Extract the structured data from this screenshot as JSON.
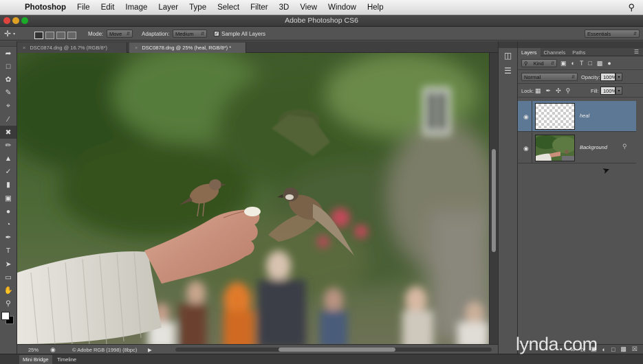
{
  "menubar": {
    "apple_icon": "apple-icon",
    "items": [
      "Photoshop",
      "File",
      "Edit",
      "Image",
      "Layer",
      "Type",
      "Select",
      "Filter",
      "3D",
      "View",
      "Window",
      "Help"
    ],
    "search_icon": "search-icon"
  },
  "window": {
    "title": "Adobe Photoshop CS6"
  },
  "options": {
    "mode_label": "Mode:",
    "mode_value": "Move",
    "adaptation_label": "Adaptation:",
    "adaptation_value": "Medium",
    "sample_all_layers": "Sample All Layers",
    "sample_checked": true,
    "workspace": "Essentials"
  },
  "tabs": [
    {
      "label": "DSC0874.dng @ 16.7% (RGB/8*)",
      "close": "×",
      "active": false
    },
    {
      "label": "DSC0878.dng @ 25% (heal, RGB/8*) *",
      "close": "×",
      "active": true
    }
  ],
  "tools": [
    "move",
    "marquee",
    "lasso",
    "quick-select",
    "crop",
    "eyedropper",
    "content-aware-move",
    "brush",
    "clone-stamp",
    "history-brush",
    "eraser",
    "gradient",
    "blur",
    "dodge",
    "pen",
    "type",
    "path-select",
    "shape",
    "hand",
    "zoom"
  ],
  "status": {
    "zoom": "25%",
    "profile": "© Adobe RGB (1998) (8bpc)",
    "arrow": "▶"
  },
  "bottom_tabs": [
    "Mini Bridge",
    "Timeline"
  ],
  "layers_panel": {
    "tabs": [
      "Layers",
      "Channels",
      "Paths"
    ],
    "menu_icon": "panel-menu-icon",
    "filter_kind": "Kind",
    "blend_mode": "Normal",
    "opacity_label": "Opacity:",
    "opacity_value": "100%",
    "lock_label": "Lock:",
    "fill_label": "Fill:",
    "fill_value": "100%",
    "layers": [
      {
        "name": "heal",
        "selected": true,
        "visible": true,
        "locked": false
      },
      {
        "name": "Background",
        "selected": false,
        "visible": true,
        "locked": true
      }
    ]
  },
  "watermark": "lynda.com"
}
